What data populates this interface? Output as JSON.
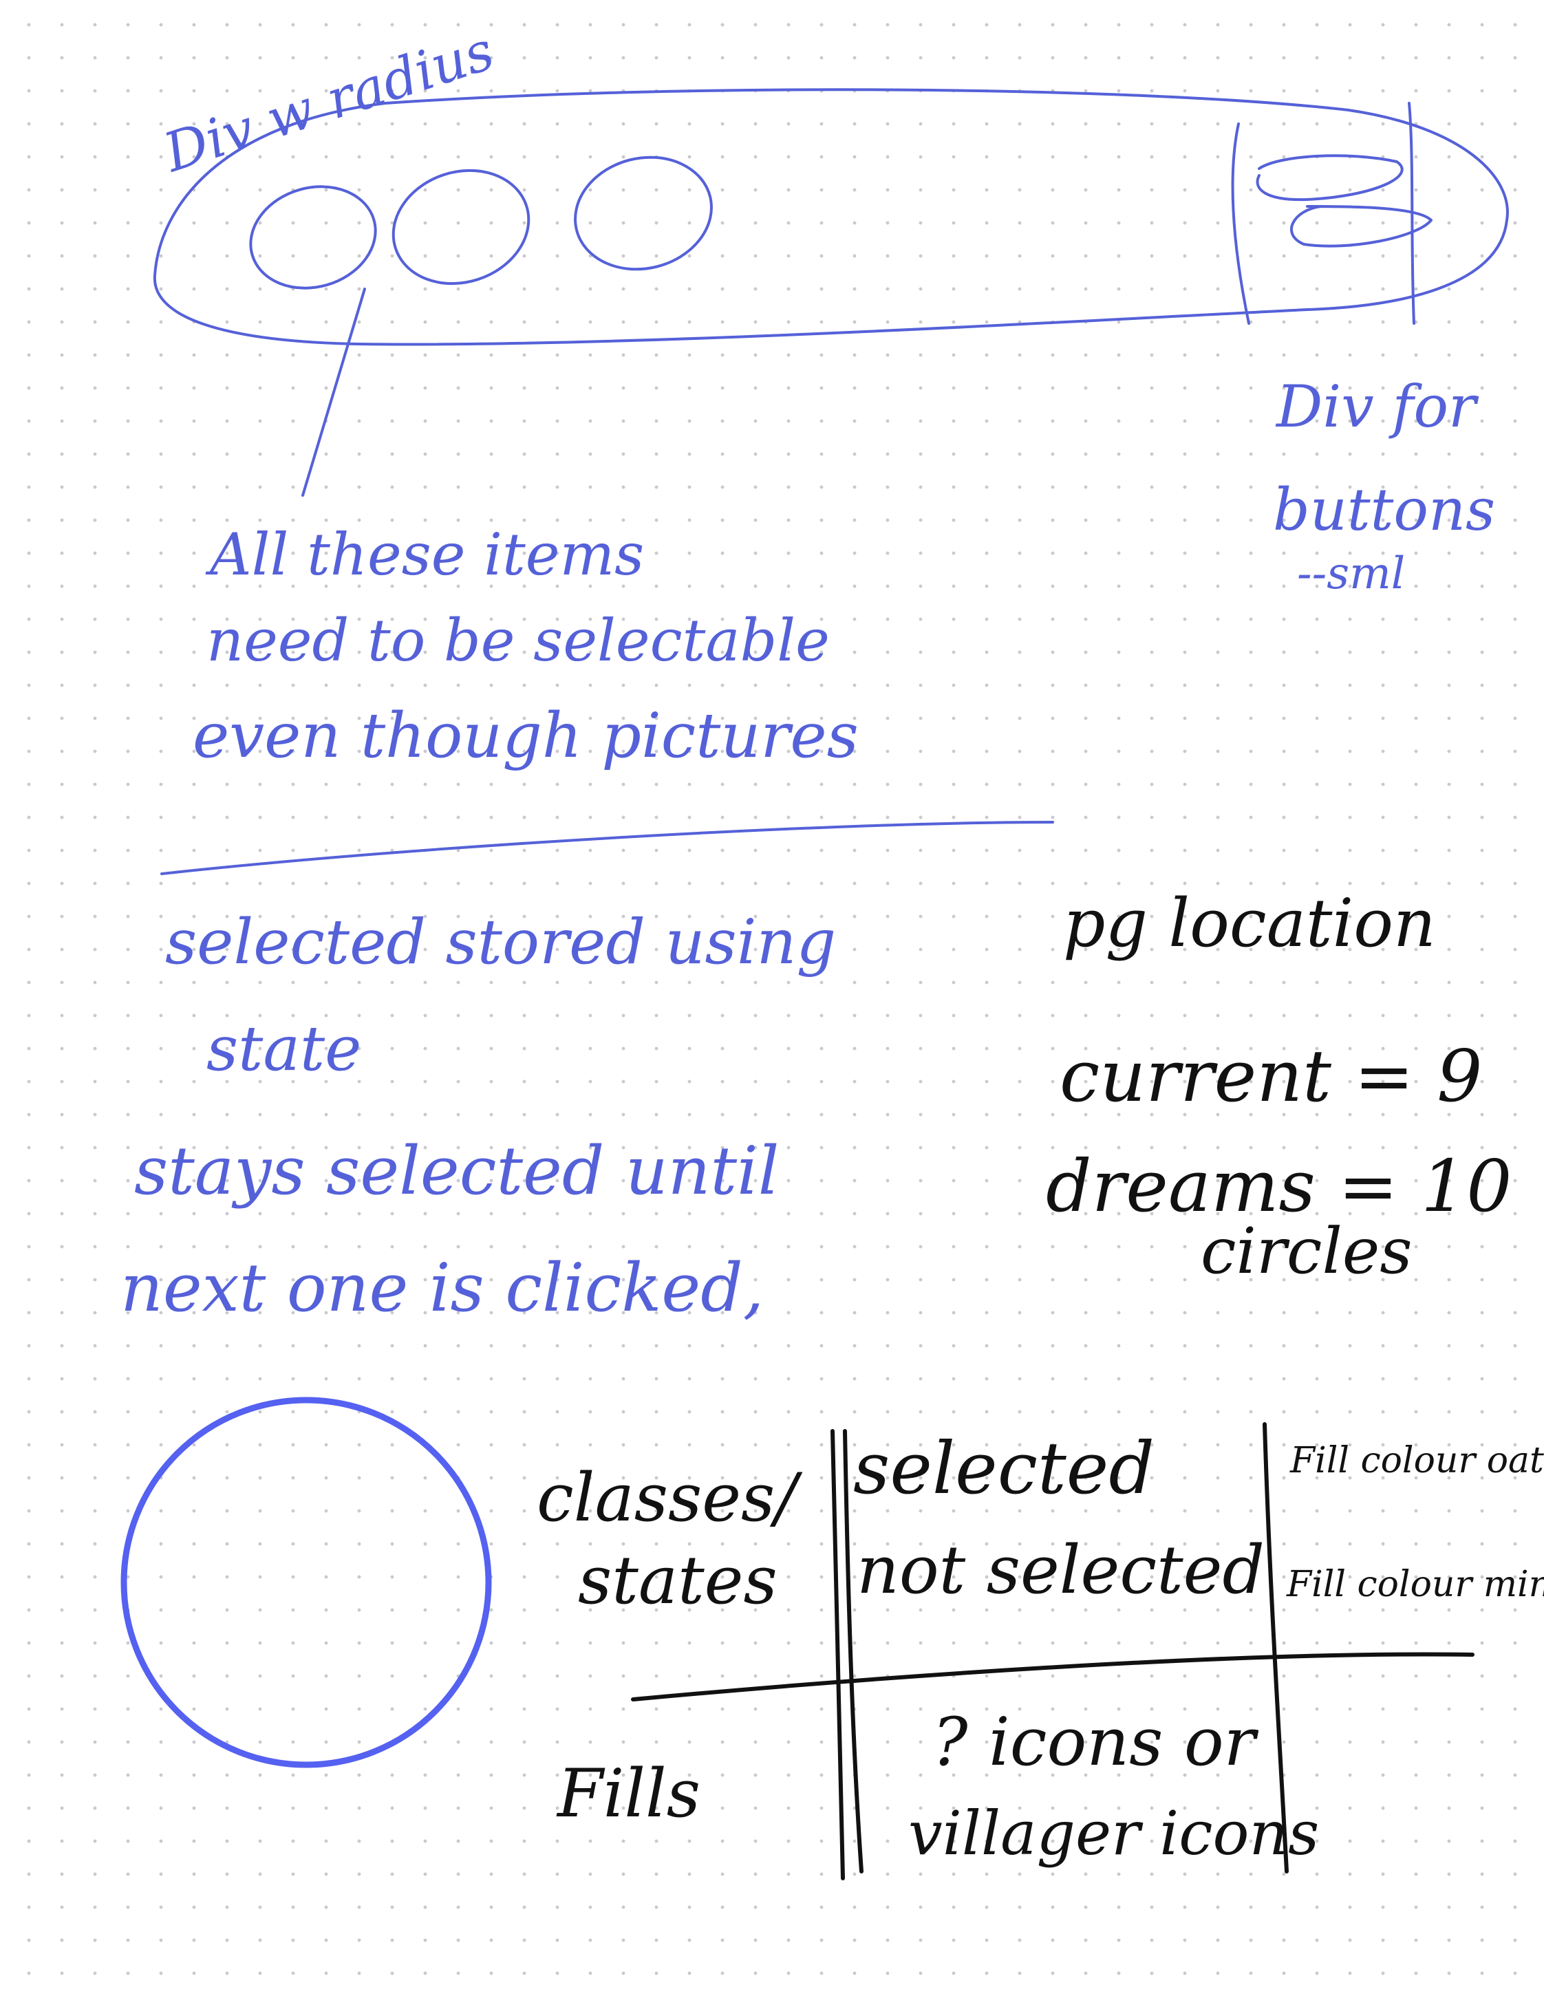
{
  "labels": {
    "outer_div": "Div w radius",
    "buttons_div_line1": "Div for",
    "buttons_div_line2": "buttons",
    "buttons_div_line3": "--sml"
  },
  "notes": {
    "selectable": [
      "All these items",
      "need to be selectable",
      "even though pictures"
    ],
    "state": [
      "selected stored using",
      "state",
      "stays selected until",
      "next one is clicked,"
    ],
    "page_location": [
      "pg location",
      "current = 9",
      "dreams = 10",
      "circles"
    ]
  },
  "table": {
    "corner_header": [
      "classes/",
      "states"
    ],
    "states": [
      "selected",
      "not selected"
    ],
    "fills": [
      "Fill colour oat",
      "Fill colour mint"
    ],
    "row_label": "Fills",
    "row_value": [
      "? icons or",
      "villager icons"
    ]
  },
  "colors": {
    "ink_blue": "#5561d8",
    "ink_black": "#111111",
    "circle_blue": "#5561f0",
    "dot_grid": "#c9c9cf"
  }
}
